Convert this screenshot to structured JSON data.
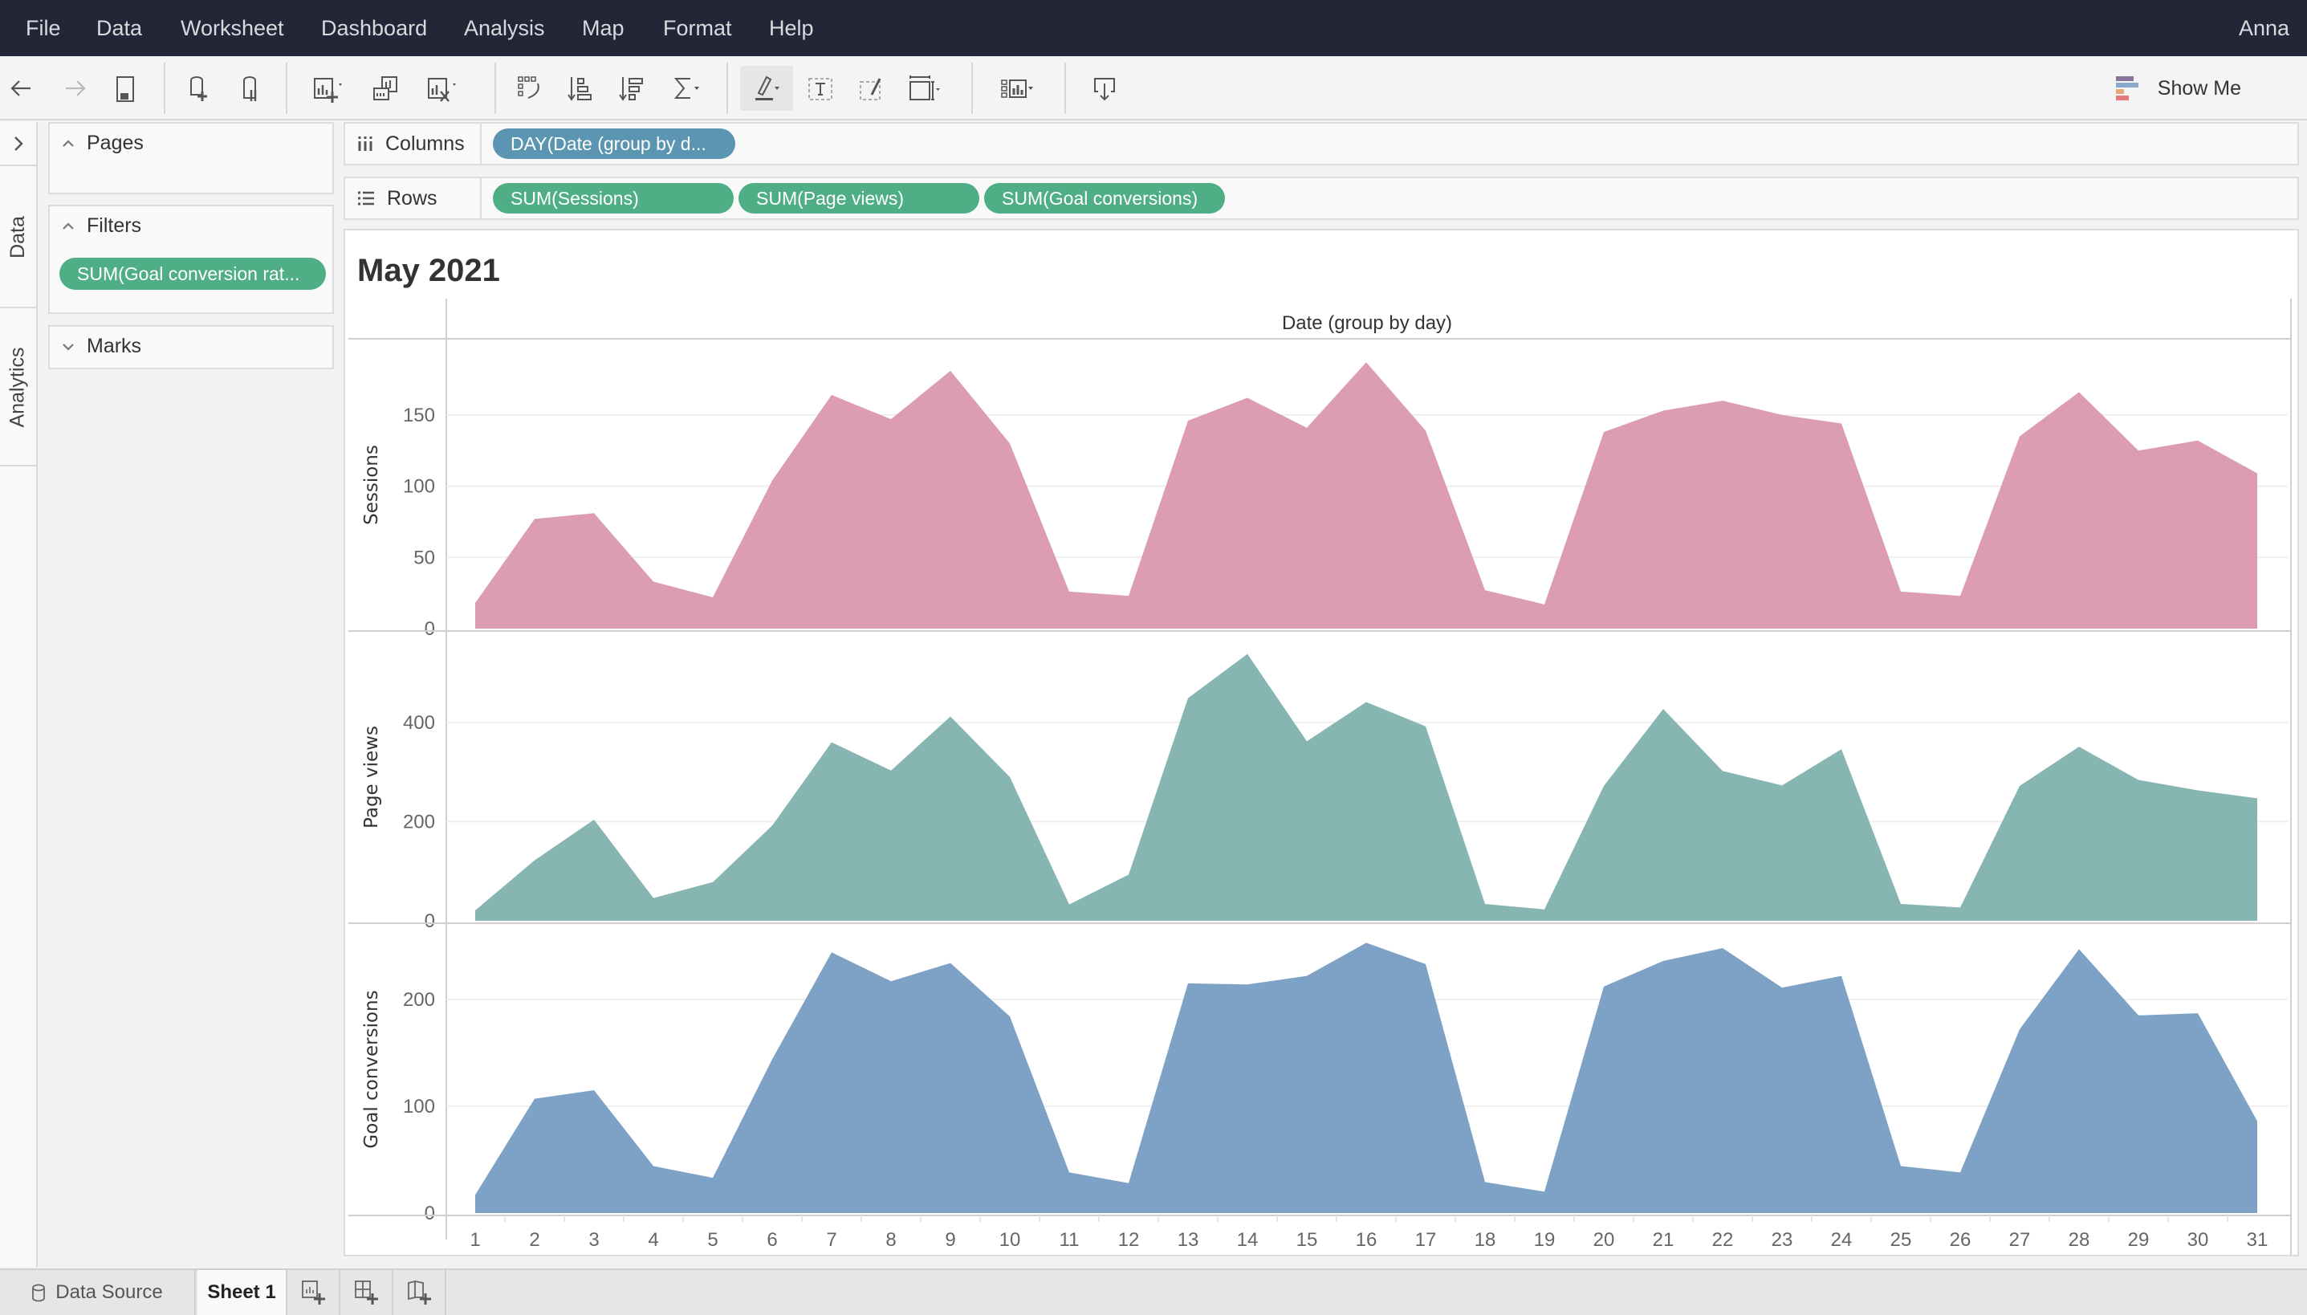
{
  "menubar": {
    "items": [
      "File",
      "Data",
      "Worksheet",
      "Dashboard",
      "Analysis",
      "Map",
      "Format",
      "Help"
    ],
    "user": "Anna"
  },
  "toolbar": {
    "show_me_label": "Show Me",
    "show_me_colors": [
      "#86749a",
      "#8aa8c9",
      "#e8a67b",
      "#e67a7f"
    ]
  },
  "left_strip": {
    "tabs": [
      "Data",
      "Analytics"
    ]
  },
  "cards": {
    "pages_label": "Pages",
    "filters_label": "Filters",
    "filter_pill": "SUM(Goal conversion rat...",
    "marks_label": "Marks"
  },
  "shelves": {
    "columns_label": "Columns",
    "columns_pills": [
      "DAY(Date (group by d..."
    ],
    "rows_label": "Rows",
    "rows_pills": [
      "SUM(Sessions)",
      "SUM(Page views)",
      "SUM(Goal conversions)"
    ]
  },
  "colors": {
    "pill_green": "#4fae86",
    "pill_blue": "#5b95b2",
    "sessions": "#dc9cb2",
    "page_views": "#86b5b2",
    "goal_conversions": "#7ea1c6"
  },
  "viz": {
    "title": "May 2021"
  },
  "chart_data": {
    "type": "area",
    "title": "May 2021",
    "xlabel": "Date (group by day)",
    "x": [
      1,
      2,
      3,
      4,
      5,
      6,
      7,
      8,
      9,
      10,
      11,
      12,
      13,
      14,
      15,
      16,
      17,
      18,
      19,
      20,
      21,
      22,
      23,
      24,
      25,
      26,
      27,
      28,
      29,
      30,
      31
    ],
    "grid": true,
    "legend": "none",
    "series": [
      {
        "name": "Sessions",
        "ylabel": "Sessions",
        "color": "#dc9cb2",
        "yticks": [
          0,
          50,
          100,
          150
        ],
        "ylim": [
          0,
          195
        ],
        "values": [
          18,
          77,
          81,
          33,
          22,
          104,
          164,
          147,
          181,
          130,
          26,
          23,
          146,
          162,
          141,
          187,
          139,
          27,
          17,
          138,
          153,
          160,
          150,
          144,
          26,
          23,
          135,
          166,
          125,
          132,
          109
        ]
      },
      {
        "name": "Page views",
        "ylabel": "Page views",
        "color": "#86b5b2",
        "yticks": [
          0,
          200,
          400
        ],
        "ylim": [
          0,
          560
        ],
        "values": [
          21,
          122,
          204,
          46,
          78,
          192,
          360,
          303,
          412,
          290,
          33,
          93,
          449,
          538,
          362,
          441,
          392,
          34,
          23,
          272,
          427,
          302,
          273,
          346,
          34,
          27,
          272,
          351,
          284,
          263,
          247
        ]
      },
      {
        "name": "Goal conversions",
        "ylabel": "Goal conversions",
        "color": "#7ea1c6",
        "yticks": [
          0,
          100,
          200
        ],
        "ylim": [
          0,
          260
        ],
        "values": [
          17,
          107,
          115,
          44,
          33,
          144,
          244,
          217,
          234,
          184,
          38,
          28,
          215,
          214,
          222,
          253,
          233,
          29,
          20,
          212,
          236,
          248,
          211,
          222,
          44,
          38,
          172,
          247,
          185,
          187,
          86
        ]
      }
    ]
  },
  "bottombar": {
    "data_source_label": "Data Source",
    "sheet_label": "Sheet 1"
  }
}
